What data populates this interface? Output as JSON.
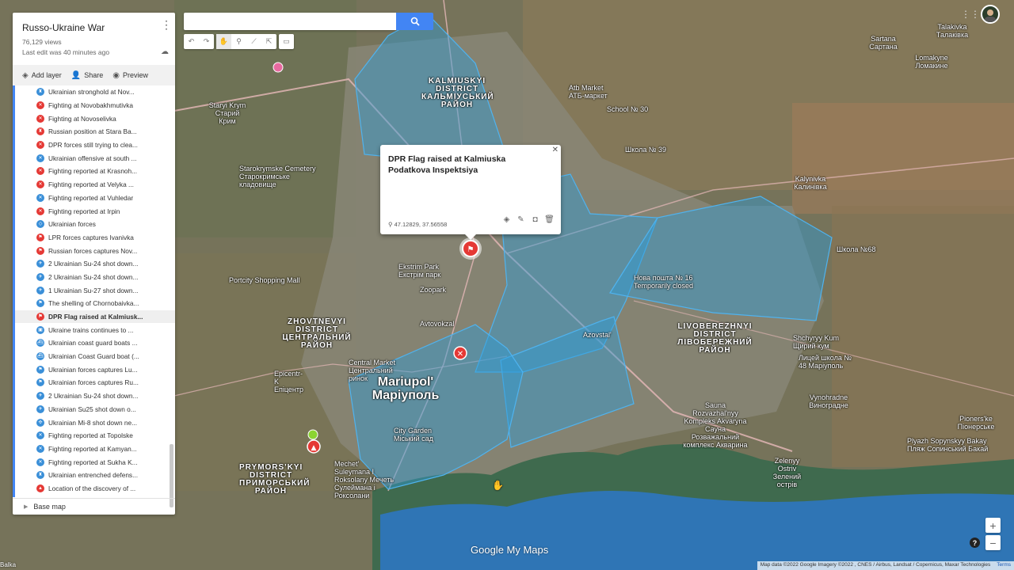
{
  "panel": {
    "title": "Russo-Ukraine War",
    "views": "76,129 views",
    "last_edit": "Last edit was 40 minutes ago",
    "actions": {
      "add_layer": "Add layer",
      "share": "Share",
      "preview": "Preview"
    },
    "items": [
      {
        "label": "Ukrainian stronghold at Nov...",
        "color": "blue",
        "icon": "fortress-icon"
      },
      {
        "label": "Fighting at Novobakhmutivka",
        "color": "red",
        "icon": "crossed-swords-icon"
      },
      {
        "label": "Fighting at Novoselivka",
        "color": "red",
        "icon": "crossed-swords-icon"
      },
      {
        "label": "Russian position at Stara Ba...",
        "color": "red",
        "icon": "fortress-icon"
      },
      {
        "label": "DPR forces still trying to clea...",
        "color": "red",
        "icon": "crossed-swords-icon"
      },
      {
        "label": "Ukrainian offensive at south ...",
        "color": "blue",
        "icon": "crossed-swords-icon"
      },
      {
        "label": "Fighting reported at Krasnoh...",
        "color": "red",
        "icon": "crossed-swords-icon"
      },
      {
        "label": "Fighting reported at Velyka ...",
        "color": "red",
        "icon": "crossed-swords-icon"
      },
      {
        "label": "Fighting reported at Vuhledar",
        "color": "blue",
        "icon": "crossed-swords-icon"
      },
      {
        "label": "Fighting reported at Irpin",
        "color": "red",
        "icon": "crossed-swords-icon"
      },
      {
        "label": "Ukrainian forces",
        "color": "blue",
        "icon": "polygon-icon"
      },
      {
        "label": "LPR forces captures Ivanivka",
        "color": "red",
        "icon": "flag-icon"
      },
      {
        "label": "Russian forces captures Nov...",
        "color": "red",
        "icon": "flag-icon"
      },
      {
        "label": "2 Ukrainian Su-24 shot down...",
        "color": "blue",
        "icon": "plane-icon"
      },
      {
        "label": "2 Ukrainian Su-24 shot down...",
        "color": "blue",
        "icon": "plane-icon"
      },
      {
        "label": "1 Ukrainian Su-27 shot down...",
        "color": "blue",
        "icon": "plane-icon"
      },
      {
        "label": "The shelling of Chornobaivka...",
        "color": "blue",
        "icon": "flag-icon"
      },
      {
        "label": "DPR Flag raised at Kalmiusk...",
        "color": "red",
        "icon": "flag-icon",
        "selected": true
      },
      {
        "label": "Ukraine trains continues to ...",
        "color": "blue",
        "icon": "train-icon"
      },
      {
        "label": "Ukrainian coast guard boats ...",
        "color": "blue",
        "icon": "boat-icon"
      },
      {
        "label": "Ukrainian Coast Guard boat (...",
        "color": "blue",
        "icon": "boat-icon"
      },
      {
        "label": "Ukrainian forces captures Lu...",
        "color": "blue",
        "icon": "flag-icon"
      },
      {
        "label": "Ukrainian forces captures Ru...",
        "color": "blue",
        "icon": "flag-icon"
      },
      {
        "label": "2 Ukrainian Su-24 shot down...",
        "color": "blue",
        "icon": "plane-icon"
      },
      {
        "label": "Ukrainian Su25 shot down o...",
        "color": "blue",
        "icon": "plane-icon"
      },
      {
        "label": "Ukrainian Mi-8 shot down ne...",
        "color": "blue",
        "icon": "helicopter-icon"
      },
      {
        "label": "Fighting reported at Topolske",
        "color": "blue",
        "icon": "crossed-swords-icon"
      },
      {
        "label": "Fighting reported at Kamyan...",
        "color": "blue",
        "icon": "crossed-swords-icon"
      },
      {
        "label": "Fighting reported at Sukha K...",
        "color": "blue",
        "icon": "crossed-swords-icon"
      },
      {
        "label": "Ukrainian entrenched defens...",
        "color": "blue",
        "icon": "fortress-icon"
      },
      {
        "label": "Location of the discovery of ...",
        "color": "red",
        "icon": "warning-icon"
      }
    ],
    "base_map": "Base map"
  },
  "search": {
    "value": "",
    "placeholder": ""
  },
  "popup": {
    "title": "DPR Flag raised at Kalmiuska Podatkova Inspektsiya",
    "coords": "47.12829, 37.56558"
  },
  "map_labels": {
    "kalmiuskyi": "KALMIUSKYI DISTRICT\nКАЛЬМІУСЬКИЙ РАЙОН",
    "zhovtnevyi": "ZHOVTNEVYI DISTRICT ЦЕНТРАЛЬНИЙ РАЙОН",
    "livoberezhnyi": "LIVOBEREZHNYI DISTRICT ЛІВОБЕРЕЖНИЙ РАЙОН",
    "prymorskyi": "PRYMORS'KYI DISTRICT ПРИМОРСЬКИЙ РАЙОН",
    "mariupol": "Mariupol' Маріуполь",
    "sartana": "Sartana Сартана",
    "talakivka": "Talakivka Талаківка",
    "lomakyne": "Lomakyne Ломакине",
    "staryi_krym": "Staryi Krym Старий Крим",
    "starokrymske": "Starokrymske Cemetery Старокримське кладовище",
    "atb": "Atb Market АТБ-маркет",
    "school30": "School № 30",
    "school39": "Школа № 39",
    "kalynivka": "Kalynivka Калинівка",
    "school68": "Школа №68",
    "ekstrim": "Ekstrim Park Екстрім парк",
    "zoopark": "Zoopark",
    "portcity": "Portcity Shopping Mall",
    "nova_poshta": "Нова пошта № 16 Temporarily closed",
    "azovstal": "Azovstal'",
    "central_market": "Central Market Центральний ринок",
    "shchyryy": "Shchyryy Kum Щирий кум",
    "school48": "Лицей школа № 48 Маріуполь",
    "vynohradne": "Vynohradne Виноградне",
    "pioners": "Pioners'ke Піонерське",
    "sauna": "Sauna Rozvazhal'nyy Kompleks Akvaryna Сауна Розважальний комплекс Акварина",
    "plyazh": "Plyazh Sopynskyy Bakay Пляж Сопинський Бакай",
    "zelenyy": "Zelenyy Ostriv Зелений острів",
    "mechet": "Mechet' Suleymana I Roksolany Мечеть Сулеймана і Роксолани",
    "epicentr": "Epicentr-K Епіцентр",
    "city_garden": "City Garden Міський сад",
    "aviovokzal": "Avtovokzal",
    "balka": "Balka"
  },
  "attribution": {
    "text": "Map data ©2022 Google Imagery ©2022 , CNES / Airbus, Landsat / Copernicus, Maxar Technologies",
    "terms": "Terms"
  },
  "branding": {
    "logo": "Google My Maps"
  },
  "colors": {
    "accent": "#4285f4",
    "red_marker": "#e53935",
    "blue_marker": "#3a8fd8",
    "polygon_fill": "#2e9bd6"
  }
}
